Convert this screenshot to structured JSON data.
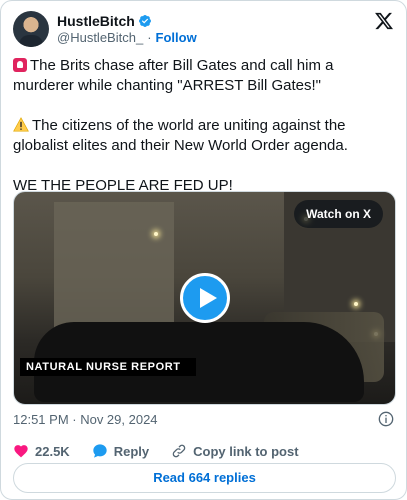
{
  "author": {
    "display_name": "HustleBitch",
    "handle": "@HustleBitch_",
    "separator": "·",
    "follow_label": "Follow"
  },
  "tweet": {
    "line1": "The Brits chase after Bill Gates and call him a murderer while chanting \"ARREST Bill Gates!\"",
    "line2": "The citizens of the world are uniting against the globalist elites and their New World Order agenda.",
    "line3": "WE THE PEOPLE ARE FED UP!"
  },
  "media": {
    "banner_text": "NATURAL NURSE REPORT",
    "watch_label": "Watch on X"
  },
  "meta": {
    "timestamp": "12:51 PM · Nov 29, 2024"
  },
  "actions": {
    "likes": "22.5K",
    "reply_label": "Reply",
    "copy_label": "Copy link to post"
  },
  "read_replies_label": "Read 664 replies",
  "colors": {
    "accent": "#1d9bf0",
    "link": "#006fd6",
    "like": "#f91880",
    "muted": "#536471"
  },
  "icons": {
    "verified": "verified-badge-icon",
    "brand": "x-logo-icon",
    "info": "info-icon",
    "like": "heart-icon",
    "reply": "speech-bubble-icon",
    "copy": "link-icon",
    "play": "play-icon"
  }
}
